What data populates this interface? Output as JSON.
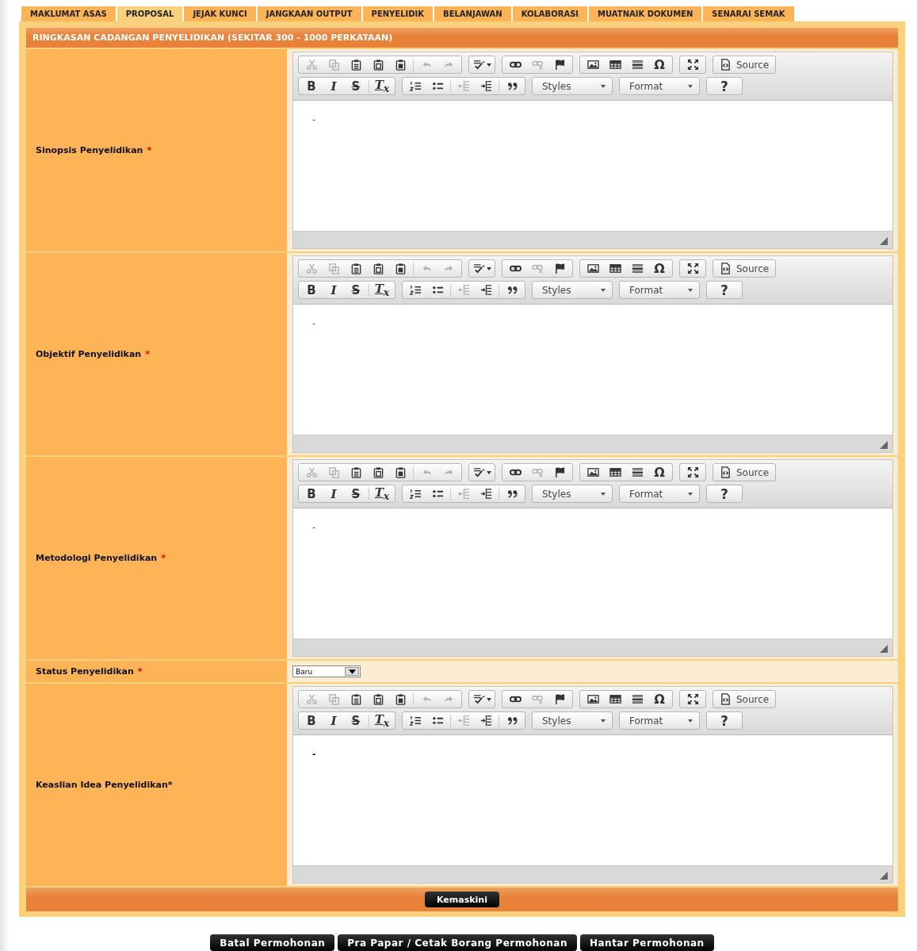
{
  "tabs": [
    {
      "label": "MAKLUMAT ASAS",
      "selected": false
    },
    {
      "label": "PROPOSAL",
      "selected": true
    },
    {
      "label": "JEJAK KUNCI",
      "selected": false
    },
    {
      "label": "JANGKAAN OUTPUT",
      "selected": false
    },
    {
      "label": "PENYELIDIK",
      "selected": false
    },
    {
      "label": "BELANJAWAN",
      "selected": false
    },
    {
      "label": "KOLABORASI",
      "selected": false
    },
    {
      "label": "MUATNAIK DOKUMEN",
      "selected": false
    },
    {
      "label": "SENARAI SEMAK",
      "selected": false
    }
  ],
  "section_title": "RINGKASAN CADANGAN PENYELIDIKAN (SEKITAR 300 - 1000 PERKATAAN)",
  "rows": [
    {
      "kind": "editor",
      "label": "Sinopsis Penyelidikan",
      "required_mark": "*",
      "content": "-",
      "combos": [
        "Styles",
        "Format"
      ],
      "buttons": [
        {
          "disabled": true
        },
        {
          "disabled": true
        },
        {
          "disabled": false
        },
        {
          "disabled": false
        },
        {
          "disabled": false
        },
        {
          "disabled": true
        },
        {
          "disabled": true
        },
        {
          "disabled": false
        },
        {
          "disabled": false
        },
        {
          "disabled": true
        },
        {
          "disabled": false
        },
        {
          "disabled": false
        },
        {
          "disabled": false
        },
        {
          "disabled": false
        },
        {
          "disabled": false,
          "label": "Ω"
        },
        {
          "disabled": false
        },
        {
          "disabled": false,
          "label": "Source"
        },
        {
          "disabled": false,
          "label": "B"
        },
        {
          "disabled": false,
          "label": "I"
        },
        {
          "disabled": false,
          "label": "S"
        },
        {
          "disabled": false,
          "label": "T$_{x}$"
        },
        {
          "disabled": false
        },
        {
          "disabled": false
        },
        {
          "disabled": true
        },
        {
          "disabled": false
        },
        {
          "disabled": false
        },
        {
          "disabled": false,
          "label": "?"
        }
      ]
    },
    {
      "kind": "editor",
      "label": "Objektif Penyelidikan",
      "required_mark": "*",
      "content": "-",
      "combos": [
        "Styles",
        "Format"
      ],
      "buttons": [
        {
          "disabled": true
        },
        {
          "disabled": true
        },
        {
          "disabled": false
        },
        {
          "disabled": false
        },
        {
          "disabled": false
        },
        {
          "disabled": true
        },
        {
          "disabled": true
        },
        {
          "disabled": false
        },
        {
          "disabled": false
        },
        {
          "disabled": true
        },
        {
          "disabled": false
        },
        {
          "disabled": false
        },
        {
          "disabled": false
        },
        {
          "disabled": false
        },
        {
          "disabled": false,
          "label": "Ω"
        },
        {
          "disabled": false
        },
        {
          "disabled": false,
          "label": "Source"
        },
        {
          "disabled": false,
          "label": "B"
        },
        {
          "disabled": false,
          "label": "I"
        },
        {
          "disabled": false,
          "label": "S"
        },
        {
          "disabled": false,
          "label": "T$_{x}$"
        },
        {
          "disabled": false
        },
        {
          "disabled": false
        },
        {
          "disabled": true
        },
        {
          "disabled": false
        },
        {
          "disabled": false
        },
        {
          "disabled": false,
          "label": "?"
        }
      ]
    },
    {
      "kind": "editor",
      "label": "Metodologi Penyelidikan",
      "required_mark": "*",
      "content": "-",
      "combos": [
        "Styles",
        "Format"
      ],
      "buttons": [
        {
          "disabled": true
        },
        {
          "disabled": true
        },
        {
          "disabled": false
        },
        {
          "disabled": false
        },
        {
          "disabled": false
        },
        {
          "disabled": true
        },
        {
          "disabled": true
        },
        {
          "disabled": false
        },
        {
          "disabled": false
        },
        {
          "disabled": true
        },
        {
          "disabled": false
        },
        {
          "disabled": false
        },
        {
          "disabled": false
        },
        {
          "disabled": false
        },
        {
          "disabled": false,
          "label": "Ω"
        },
        {
          "disabled": false
        },
        {
          "disabled": false,
          "label": "Source"
        },
        {
          "disabled": false,
          "label": "B"
        },
        {
          "disabled": false,
          "label": "I"
        },
        {
          "disabled": false,
          "label": "S"
        },
        {
          "disabled": false,
          "label": "T$_{x}$"
        },
        {
          "disabled": false
        },
        {
          "disabled": false
        },
        {
          "disabled": true
        },
        {
          "disabled": false
        },
        {
          "disabled": false
        },
        {
          "disabled": false,
          "label": "?"
        }
      ]
    },
    {
      "kind": "select",
      "label": "Status Penyelidikan",
      "required_mark": "*",
      "value": "Baru"
    },
    {
      "kind": "editor",
      "label": "Keaslian Idea Penyelidikan*",
      "content": "-",
      "combos": [
        "Styles",
        "Format"
      ],
      "buttons": [
        {
          "disabled": true
        },
        {
          "disabled": true
        },
        {
          "disabled": false
        },
        {
          "disabled": false
        },
        {
          "disabled": false
        },
        {
          "disabled": true
        },
        {
          "disabled": true
        },
        {
          "disabled": false
        },
        {
          "disabled": false
        },
        {
          "disabled": true
        },
        {
          "disabled": false
        },
        {
          "disabled": false
        },
        {
          "disabled": false
        },
        {
          "disabled": false
        },
        {
          "disabled": false,
          "label": "Ω"
        },
        {
          "disabled": false
        },
        {
          "disabled": false,
          "label": "Source"
        },
        {
          "disabled": false,
          "label": "B"
        },
        {
          "disabled": false,
          "label": "I"
        },
        {
          "disabled": false,
          "label": "S"
        },
        {
          "disabled": false,
          "label": "T$_{x}$"
        },
        {
          "disabled": false
        },
        {
          "disabled": false
        },
        {
          "disabled": true
        },
        {
          "disabled": false
        },
        {
          "disabled": false
        },
        {
          "disabled": false,
          "label": "?"
        }
      ]
    }
  ],
  "update_button": "Kemaskini",
  "actions": [
    "Batal Permohonan",
    "Pra Papar / Cetak Borang Permohonan",
    "Hantar Permohonan"
  ]
}
